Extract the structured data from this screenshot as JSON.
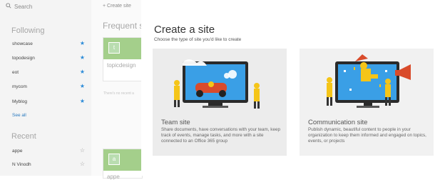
{
  "sidebar": {
    "search_placeholder": "Search",
    "following_title": "Following",
    "following": [
      {
        "label": "showcase",
        "starred": true
      },
      {
        "label": "topodesign",
        "starred": true
      },
      {
        "label": "eot",
        "starred": true
      },
      {
        "label": "mycom",
        "starred": true
      },
      {
        "label": "Myblog",
        "starred": true
      }
    ],
    "see_all": "See all",
    "recent_title": "Recent",
    "recent": [
      {
        "label": "appe",
        "starred": false
      },
      {
        "label": "N Vinodh",
        "starred": false
      }
    ]
  },
  "main": {
    "create_site": "Create site",
    "frequent_title": "Frequent s",
    "tile1_letter": "t",
    "tile1_name": "topicdesign",
    "no_recent": "There's no recent a",
    "tile2_letter": "a",
    "tile2_name": "appe"
  },
  "panel": {
    "title": "Create a site",
    "subtitle": "Choose the type of site you'd like to create",
    "team_title": "Team site",
    "team_desc": "Share documents, have conversations with your team, keep track of events, manage tasks, and more with a site connected to an Office 365 group",
    "comm_title": "Communication site",
    "comm_desc": "Publish dynamic, beautiful content to people in your organization to keep them informed and engaged on topics, events, or projects"
  },
  "colors": {
    "accent": "#2b8bd8",
    "tile_green": "#a4cf8b",
    "figure_yellow": "#f5c518"
  }
}
